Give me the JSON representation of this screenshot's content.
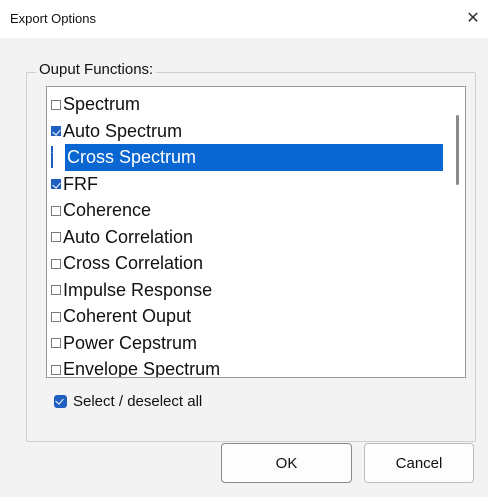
{
  "window": {
    "title": "Export Options",
    "close_glyph": "✕"
  },
  "group": {
    "label": "Ouput Functions:"
  },
  "functions": [
    {
      "label": "Spectrum",
      "checked": false,
      "selected": false
    },
    {
      "label": "Auto Spectrum",
      "checked": true,
      "selected": false
    },
    {
      "label": "Cross Spectrum",
      "checked": true,
      "selected": true
    },
    {
      "label": "FRF",
      "checked": true,
      "selected": false
    },
    {
      "label": "Coherence",
      "checked": false,
      "selected": false
    },
    {
      "label": "Auto Correlation",
      "checked": false,
      "selected": false
    },
    {
      "label": "Cross Correlation",
      "checked": false,
      "selected": false
    },
    {
      "label": "Impulse Response",
      "checked": false,
      "selected": false
    },
    {
      "label": "Coherent Ouput",
      "checked": false,
      "selected": false
    },
    {
      "label": "Power Cepstrum",
      "checked": false,
      "selected": false
    },
    {
      "label": "Envelope Spectrum",
      "checked": false,
      "selected": false
    }
  ],
  "select_all": {
    "label": "Select / deselect all",
    "checked": true
  },
  "buttons": {
    "ok_label": "OK",
    "cancel_label": "Cancel"
  },
  "colors": {
    "selection": "#0a66d1",
    "checkbox_checked": "#1f5fbf"
  }
}
